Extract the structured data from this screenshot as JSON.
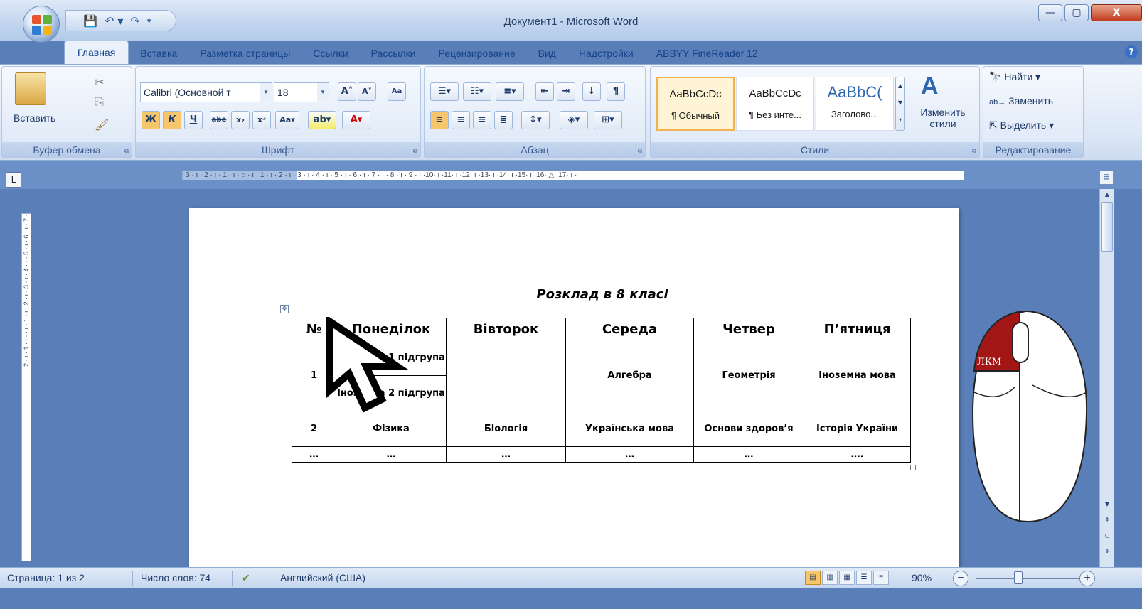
{
  "window": {
    "title": "Документ1 - Microsoft Word",
    "buttons": [
      "—",
      "▢",
      "X"
    ]
  },
  "tabs": [
    "Главная",
    "Вставка",
    "Разметка страницы",
    "Ссылки",
    "Рассылки",
    "Рецензирование",
    "Вид",
    "Надстройки",
    "ABBYY FineReader 12"
  ],
  "ribbon": {
    "clipboard": {
      "paste": "Вставить",
      "label": "Буфер обмена"
    },
    "font": {
      "name": "Calibri (Основной т",
      "size": "18",
      "label": "Шрифт"
    },
    "paragraph": {
      "label": "Абзац"
    },
    "styles": {
      "items": [
        {
          "preview": "AaBbCcDc",
          "name": "¶ Обычный"
        },
        {
          "preview": "AaBbCcDc",
          "name": "¶ Без инте..."
        },
        {
          "preview": "AaBbC(",
          "name": "Заголово..."
        }
      ],
      "change": "Изменить стили",
      "label": "Стили"
    },
    "editing": {
      "find": "Найти",
      "replace": "Заменить",
      "select": "Выделить",
      "label": "Редактирование"
    }
  },
  "ruler": {
    "horizontal": "3 · ı · 2 · ı · 1 · ı · ⌂ · ı · 1 · ı · 2 · ı · 3 · ı · 4 · ı · 5 · ı · 6 · ı · 7 · ı · 8 · ı · 9 · ı ·10· ı ·11· ı ·12· ı ·13· ı ·14· ı ·15· ı ·16· △ ·17· ı ·",
    "vertical": "2 · ı · 1 · ı · · ı · 1 · ı · 2 · ı · 3 · ı · 4 · ı · 5 · ı · 6 · ı · 7 ·"
  },
  "document": {
    "title": "Розклад в 8 класі",
    "table": {
      "headers": [
        "№",
        "Понеділок",
        "Вівторок",
        "Середа",
        "Четвер",
        "П’ятниця"
      ],
      "row1": {
        "num": "1",
        "mon_a": "Іноземна 1 підгрупа",
        "mon_b": "Іноземна 2 підгрупа",
        "tue": "",
        "wed": "Алгебра",
        "thu": "Геометрія",
        "fri": "Іноземна мова"
      },
      "row2": [
        "2",
        "Фізика",
        "Біологія",
        "Українська  мова",
        "Основи здоров’я",
        "Історія України"
      ],
      "row3": [
        "…",
        "…",
        "…",
        "…",
        "…",
        "…."
      ]
    }
  },
  "mouse": {
    "label": "ЛКМ",
    "accent": "#a31616"
  },
  "status": {
    "page": "Страница: 1 из 2",
    "words": "Число слов: 74",
    "language": "Английский (США)",
    "zoom": "90%"
  }
}
